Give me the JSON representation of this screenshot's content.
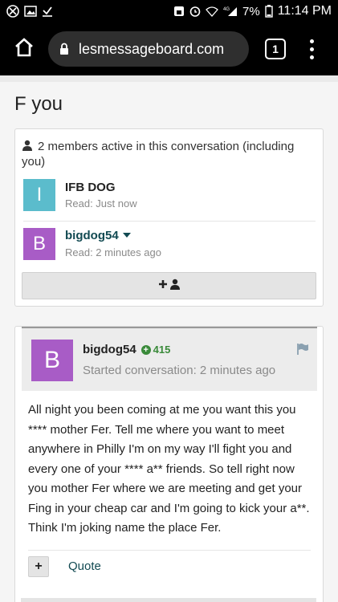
{
  "status_bar": {
    "battery_percent": "7%",
    "time": "11:14 PM",
    "network": "4G"
  },
  "browser": {
    "url": "lesmessageboard.com",
    "tab_count": "1"
  },
  "page": {
    "title": "F you"
  },
  "members": {
    "header": "2 members active in this conversation (including you)",
    "list": [
      {
        "initial": "I",
        "name": "IFB DOG",
        "read": "Read: Just now",
        "color": "#5bbccc"
      },
      {
        "initial": "B",
        "name": "bigdog54",
        "read": "Read: 2 minutes ago",
        "color": "#a85cc6"
      }
    ]
  },
  "post": {
    "avatar_initial": "B",
    "author": "bigdog54",
    "reputation": "415",
    "started": "Started conversation: 2 minutes ago",
    "body": "All night you been coming at me you want this you **** mother Fer. Tell me where you want to meet anywhere in Philly I'm on my way I'll fight you and every one of your **** a** friends. So tell right now you mother Fer where we are meeting and get your Fing in your cheap car and I'm going to kick your a**. Think I'm joking name the place Fer.",
    "plus_label": "+",
    "quote_label": "Quote"
  }
}
